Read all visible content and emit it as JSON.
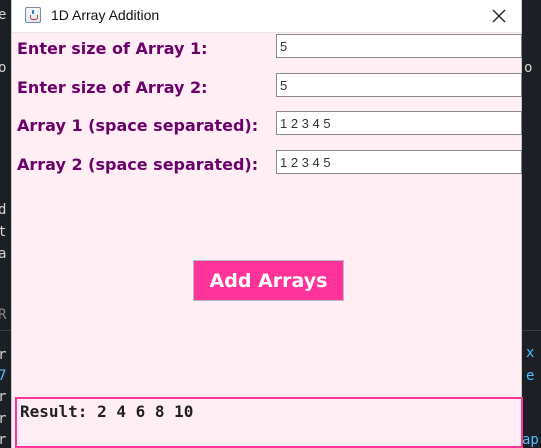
{
  "window": {
    "title": "1D Array Addition",
    "close_symbol": "✕"
  },
  "form": {
    "fields": [
      {
        "label": "Enter size of Array 1:",
        "value": "5"
      },
      {
        "label": "Enter size of Array 2:",
        "value": "5"
      },
      {
        "label": "Array 1 (space separated):",
        "value": "1 2 3 4 5"
      },
      {
        "label": "Array 2 (space separated):",
        "value": "1 2 3 4 5"
      }
    ],
    "button_label": "Add Arrays"
  },
  "result": {
    "text": "Result: 2 4 6 8 10"
  },
  "colors": {
    "label": "#6b006b",
    "button": "#ff3399",
    "window_bg": "#ffeef4"
  },
  "icons": {
    "app": "java-app-icon",
    "close": "close-icon"
  }
}
